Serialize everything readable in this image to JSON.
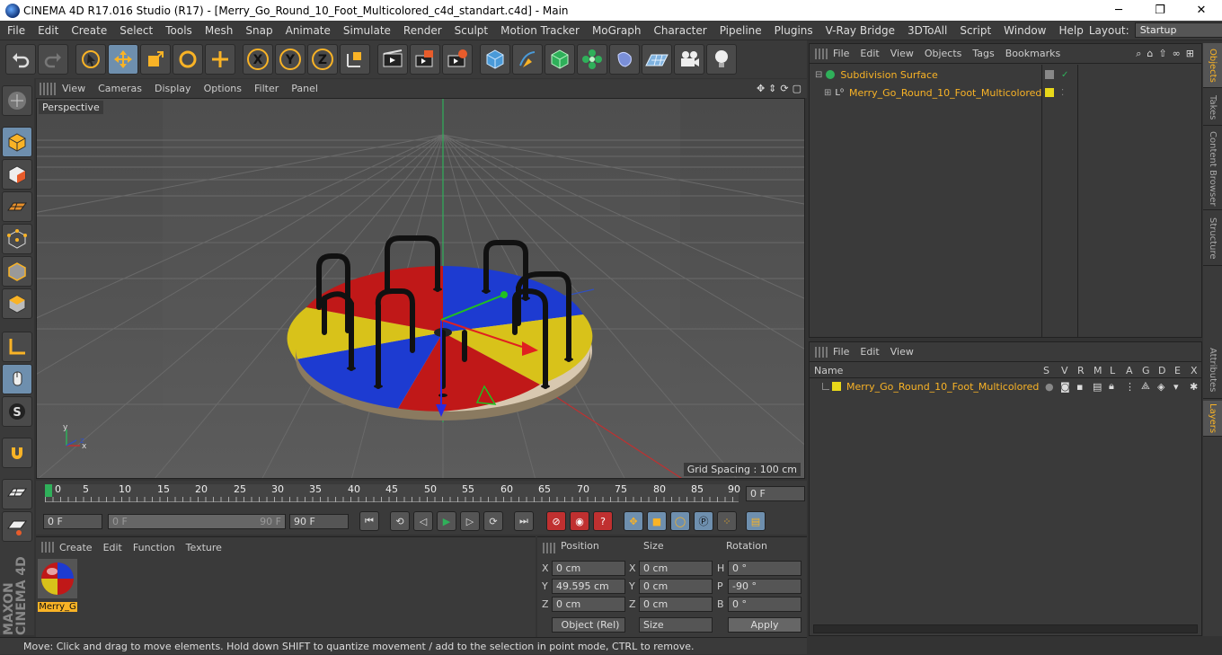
{
  "window": {
    "title": "CINEMA 4D R17.016 Studio (R17) - [Merry_Go_Round_10_Foot_Multicolored_c4d_standart.c4d] - Main",
    "minimize": "─",
    "maximize": "❐",
    "close": "✕"
  },
  "menu": [
    "File",
    "Edit",
    "Create",
    "Select",
    "Tools",
    "Mesh",
    "Snap",
    "Animate",
    "Simulate",
    "Render",
    "Sculpt",
    "Motion Tracker",
    "MoGraph",
    "Character",
    "Pipeline",
    "Plugins",
    "V-Ray Bridge",
    "3DToAll",
    "Script",
    "Window",
    "Help"
  ],
  "layout": {
    "label": "Layout:",
    "value": "Startup"
  },
  "toolbar_icons": [
    "undo-icon",
    "redo-icon",
    "live-selection-icon",
    "move-icon",
    "scale-icon",
    "rotate-icon",
    "last-tool-icon",
    "x-axis-icon",
    "y-axis-icon",
    "z-axis-icon",
    "world-coordinates-icon",
    "render-view-icon",
    "render-picture-viewer-icon",
    "edit-render-settings-icon",
    "cube-icon",
    "pen-icon",
    "subdivision-icon",
    "cloner-icon",
    "deformer-icon",
    "floor-icon",
    "camera-icon",
    "light-icon"
  ],
  "viewport": {
    "menu": [
      "View",
      "Cameras",
      "Display",
      "Options",
      "Filter",
      "Panel"
    ],
    "label": "Perspective",
    "grid_spacing": "Grid Spacing : 100 cm"
  },
  "timeline": {
    "ticks": [
      "0",
      "5",
      "10",
      "15",
      "20",
      "25",
      "30",
      "35",
      "40",
      "45",
      "50",
      "55",
      "60",
      "65",
      "70",
      "75",
      "80",
      "85",
      "90"
    ],
    "current": "0 F"
  },
  "transport": {
    "start": "0 F",
    "range_start": "0 F",
    "range_end": "90 F",
    "end": "90 F"
  },
  "material": {
    "menu": [
      "Create",
      "Edit",
      "Function",
      "Texture"
    ],
    "name": "Merry_G"
  },
  "coords": {
    "headers": [
      "Position",
      "Size",
      "Rotation"
    ],
    "rows": [
      {
        "axis": "X",
        "pos": "0 cm",
        "saxis": "X",
        "size": "0 cm",
        "raxis": "H",
        "rot": "0 °"
      },
      {
        "axis": "Y",
        "pos": "49.595 cm",
        "saxis": "Y",
        "size": "0 cm",
        "raxis": "P",
        "rot": "-90 °"
      },
      {
        "axis": "Z",
        "pos": "0 cm",
        "saxis": "Z",
        "size": "0 cm",
        "raxis": "B",
        "rot": "0 °"
      }
    ],
    "mode": "Object (Rel)",
    "size_mode": "Size",
    "apply": "Apply"
  },
  "status": "Move: Click and drag to move elements. Hold down SHIFT to quantize movement / add to the selection in point mode, CTRL to remove.",
  "objects": {
    "menu": [
      "File",
      "Edit",
      "View",
      "Objects",
      "Tags",
      "Bookmarks"
    ],
    "items": [
      "Subdivision Surface",
      "Merry_Go_Round_10_Foot_Multicolored"
    ]
  },
  "layers": {
    "menu": [
      "File",
      "Edit",
      "View"
    ],
    "columns_label": "Name",
    "cols": [
      "S",
      "V",
      "R",
      "M",
      "L",
      "A",
      "G",
      "D",
      "E",
      "X"
    ],
    "item": "Merry_Go_Round_10_Foot_Multicolored"
  },
  "side_tabs": [
    "Objects",
    "Takes",
    "Content Browser",
    "Structure",
    "Attributes",
    "Layers"
  ],
  "colors": {
    "accent": "#f9b326",
    "highlight": "#6e8fae"
  }
}
